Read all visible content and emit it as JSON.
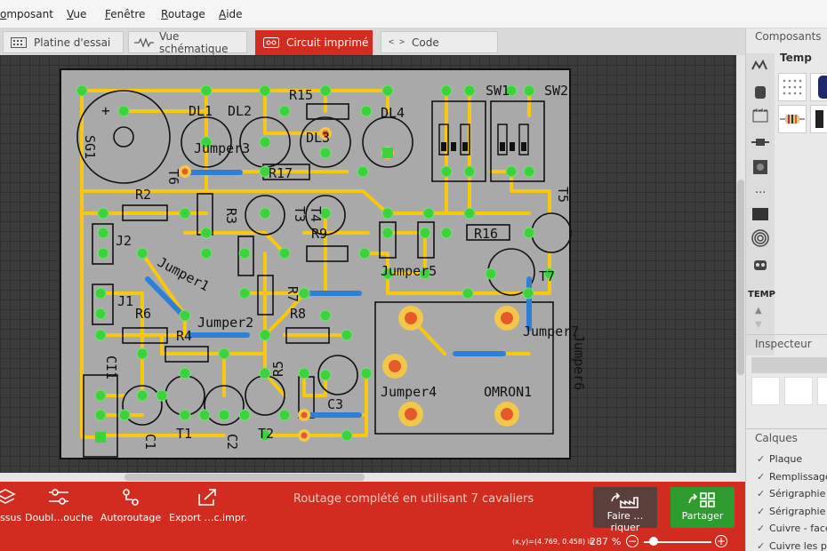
{
  "menu": {
    "items": [
      "omposant",
      "Vue",
      "Fenêtre",
      "Routage",
      "Aide"
    ]
  },
  "tabs": [
    {
      "label": "Platine d'essai",
      "icon": "breadboard-icon"
    },
    {
      "label": "Vue schématique",
      "icon": "schematic-icon"
    },
    {
      "label": "Circuit imprimé",
      "icon": "pcb-icon",
      "active": true
    },
    {
      "label": "Code",
      "icon": "code-icon"
    }
  ],
  "pcb": {
    "labels": {
      "sg1": "SG1",
      "dl1": "DL1",
      "dl2": "DL2",
      "dl3": "DL3",
      "dl4": "DL4",
      "r15": "R15",
      "r17": "R17",
      "r2": "R2",
      "r3": "R3",
      "r9": "R9",
      "r16": "R16",
      "r6": "R6",
      "r4": "R4",
      "r7": "R7",
      "r8": "R8",
      "r5": "R5",
      "jumper3": "Jumper3",
      "jumper1": "Jumper1",
      "jumper2": "Jumper2",
      "jumper5": "Jumper5",
      "jumper4": "Jumper4",
      "jumper7": "Jumper7",
      "jumper6": "Jumper6",
      "sw1": "SW1",
      "sw2": "SW2",
      "t6": "T6",
      "t5": "T5",
      "t7": "T7",
      "t1": "T1",
      "t2": "T2",
      "t3": "T3",
      "t4": "T4",
      "j1": "J1",
      "j2": "J2",
      "c1": "C1",
      "c2": "C2",
      "c3": "C3",
      "ci1": "CI1",
      "omron1": "OMRON1",
      "plus": "+"
    }
  },
  "toolbar": {
    "buttons": [
      {
        "label": "ssus",
        "icon": "layers-icon"
      },
      {
        "label": "Doubl…ouche",
        "icon": "double-layer-icon"
      },
      {
        "label": "Autoroutage",
        "icon": "autoroute-icon"
      },
      {
        "label": "Export …c.impr.",
        "icon": "export-icon"
      }
    ],
    "status": "Routage complété en utilisant 7 cavaliers",
    "fab_order": "Faire …riquer",
    "fab_share": "Partager"
  },
  "statusbar": {
    "coords": "(x,y)=(4.769, 0.458) in",
    "zoom": "287",
    "zoom_unit": "%"
  },
  "side": {
    "components_title": "Composants",
    "bin_name": "Temp",
    "bin_tab": "TEMP",
    "more": "...",
    "inspector_title": "Inspecteur",
    "layers_title": "Calques",
    "layers": [
      "Plaque",
      "Remplissage",
      "Sérigraphie c",
      "Sérigraphie c",
      "Cuivre - face",
      "Cuivre les pi"
    ]
  },
  "colors": {
    "accent": "#d22c20",
    "board": "#a9a9a9",
    "trace": "#f6c90e",
    "pad": "#3ed13e",
    "jumper": "#2f7fd6"
  }
}
